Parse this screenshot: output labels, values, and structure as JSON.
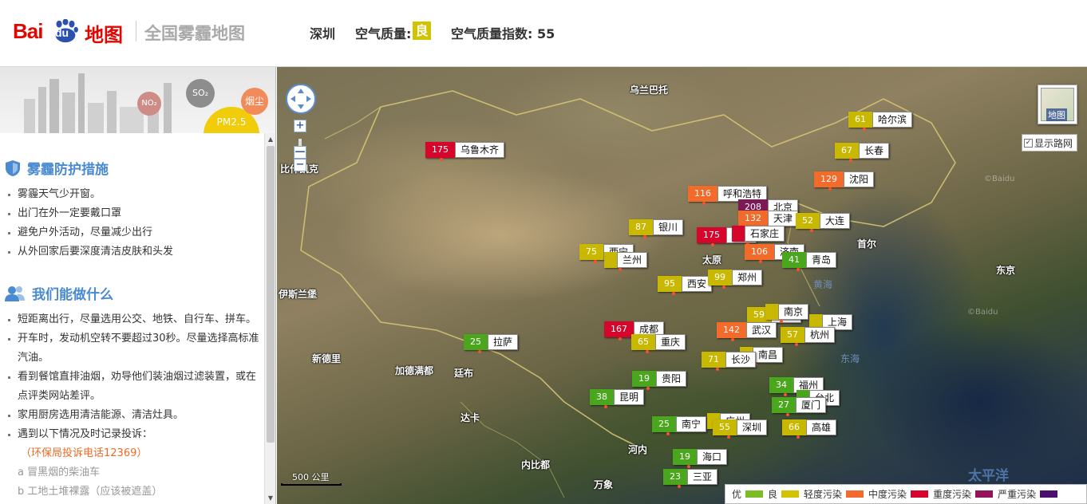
{
  "header": {
    "logo_bai": "Bai",
    "logo_du": "du",
    "logo_map": "地图",
    "site_title": "全国雾霾地图",
    "city": "深圳",
    "quality_label": "空气质量:",
    "quality_value": "良",
    "index_label": "空气质量指数: 55"
  },
  "banner": {
    "no2": "NO₂",
    "so2": "SO₂",
    "pm25": "PM2.5",
    "dust": "烟尘"
  },
  "protect": {
    "title": "雾霾防护措施",
    "items": [
      "雾霾天气少开窗。",
      "出门在外一定要戴口罩",
      "避免户外活动，尽量减少出行",
      "从外回家后要深度清洁皮肤和头发"
    ]
  },
  "todo": {
    "title": "我们能做什么",
    "items": [
      "短距离出行，尽量选用公交、地铁、自行车、拼车。",
      "开车时，发动机空转不要超过30秒。尽量选择高标准汽油。",
      "看到餐馆直排油烟，劝导他们装油烟过滤装置，或在点评类网站差评。",
      "家用厨房选用清洁能源、清洁灶具。",
      "遇到以下情况及时记录投诉："
    ],
    "hotline": "（环保局投诉电话12369）",
    "sub_a": "a 冒黑烟的柴油车",
    "sub_b": "b 工地土堆裸露（应该被遮盖）"
  },
  "map": {
    "labels": {
      "ulaanbaatar": "乌兰巴托",
      "bishkek": "比什凯克",
      "islamabad": "伊斯兰堡",
      "newdelhi": "新德里",
      "kathmandu": "加德满都",
      "thimphu": "廷布",
      "dhaka": "达卡",
      "hanoi": "河内",
      "naypyidaw": "内比都",
      "vientiane": "万象",
      "seoul": "首尔",
      "tokyo": "东京",
      "taiyuan_base": "太原",
      "hefei_base": "合肥",
      "yellow_sea": "黄海",
      "east_sea": "东海",
      "pacific": "太平洋"
    },
    "copyright_1": "©Baidu",
    "copyright_2": "©Baidu",
    "scale": "500 公里",
    "map_toggle": "地图",
    "road_toggle": "显示路网",
    "zoom_in": "+",
    "zoom_out": "−"
  },
  "stations": [
    {
      "aqi": "175",
      "city": "乌鲁木齐",
      "level": "heavy"
    },
    {
      "aqi": "61",
      "city": "哈尔滨",
      "level": "light"
    },
    {
      "aqi": "67",
      "city": "长春",
      "level": "light"
    },
    {
      "aqi": "129",
      "city": "沈阳",
      "level": "moderate"
    },
    {
      "aqi": "116",
      "city": "呼和浩特",
      "level": "moderate"
    },
    {
      "aqi": "208",
      "city": "北京",
      "level": "severe"
    },
    {
      "aqi": "132",
      "city": "天津",
      "level": "moderate"
    },
    {
      "aqi": "52",
      "city": "大连",
      "level": "light"
    },
    {
      "aqi": "87",
      "city": "银川",
      "level": "light"
    },
    {
      "aqi": "175",
      "city": "太原",
      "level": "heavy"
    },
    {
      "aqi": "",
      "city": "石家庄",
      "level": "heavy"
    },
    {
      "aqi": "75",
      "city": "西宁",
      "level": "light"
    },
    {
      "aqi": "",
      "city": "兰州",
      "level": "light"
    },
    {
      "aqi": "106",
      "city": "济南",
      "level": "moderate"
    },
    {
      "aqi": "41",
      "city": "青岛",
      "level": "good"
    },
    {
      "aqi": "95",
      "city": "西安",
      "level": "light"
    },
    {
      "aqi": "99",
      "city": "郑州",
      "level": "light"
    },
    {
      "aqi": "59",
      "city": "合肥",
      "level": "light"
    },
    {
      "aqi": "",
      "city": "南京",
      "level": "light"
    },
    {
      "aqi": "",
      "city": "上海",
      "level": "light"
    },
    {
      "aqi": "167",
      "city": "成都",
      "level": "heavy"
    },
    {
      "aqi": "142",
      "city": "武汉",
      "level": "moderate"
    },
    {
      "aqi": "57",
      "city": "杭州",
      "level": "light"
    },
    {
      "aqi": "25",
      "city": "拉萨",
      "level": "good"
    },
    {
      "aqi": "65",
      "city": "重庆",
      "level": "light"
    },
    {
      "aqi": "",
      "city": "南昌",
      "level": "light"
    },
    {
      "aqi": "71",
      "city": "长沙",
      "level": "light"
    },
    {
      "aqi": "19",
      "city": "贵阳",
      "level": "good"
    },
    {
      "aqi": "34",
      "city": "福州",
      "level": "good"
    },
    {
      "aqi": "",
      "city": "台北",
      "level": "good"
    },
    {
      "aqi": "38",
      "city": "昆明",
      "level": "good"
    },
    {
      "aqi": "27",
      "city": "厦门",
      "level": "good"
    },
    {
      "aqi": "25",
      "city": "南宁",
      "level": "good"
    },
    {
      "aqi": "",
      "city": "广州",
      "level": "light"
    },
    {
      "aqi": "55",
      "city": "深圳",
      "level": "light"
    },
    {
      "aqi": "66",
      "city": "高雄",
      "level": "light"
    },
    {
      "aqi": "19",
      "city": "海口",
      "level": "good"
    },
    {
      "aqi": "23",
      "city": "三亚",
      "level": "good"
    }
  ],
  "legend": [
    {
      "label": "优",
      "color": "#7cbc24"
    },
    {
      "label": "良",
      "color": "#d2c300"
    },
    {
      "label": "轻度污染",
      "color": "#f36a2e"
    },
    {
      "label": "中度污染",
      "color": "#d9042c"
    },
    {
      "label": "重度污染",
      "color": "#94135a"
    },
    {
      "label": "严重污染",
      "color": "#4b0f6e"
    }
  ],
  "level_colors": {
    "good": "#4aa61d",
    "light": "#c9b800",
    "moderate": "#f26b2a",
    "heavy": "#d5052c",
    "severe": "#7b1a55"
  }
}
